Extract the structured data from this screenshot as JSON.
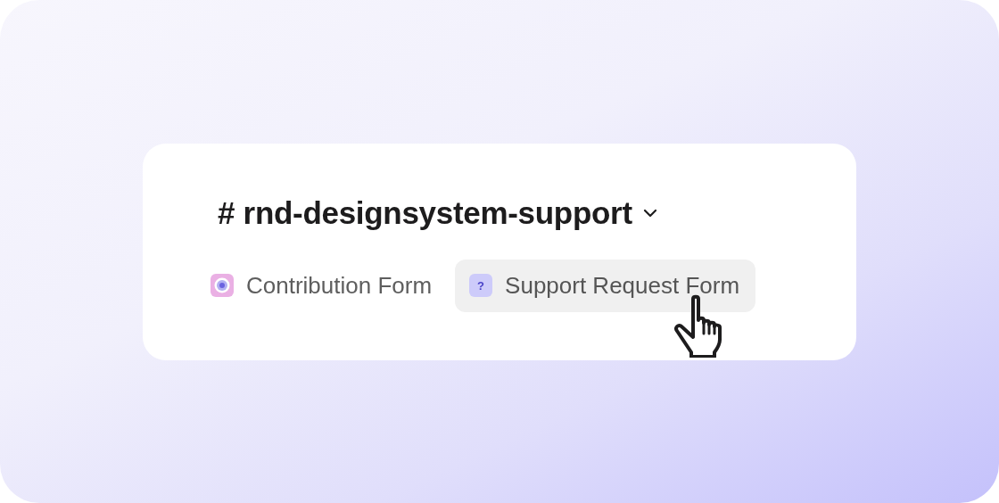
{
  "channel": {
    "title": "# rnd-designsystem-support"
  },
  "tabs": [
    {
      "kind": "target",
      "label": "Contribution Form",
      "hovered": false
    },
    {
      "kind": "question",
      "glyph": "?",
      "label": "Support Request Form",
      "hovered": true
    }
  ]
}
